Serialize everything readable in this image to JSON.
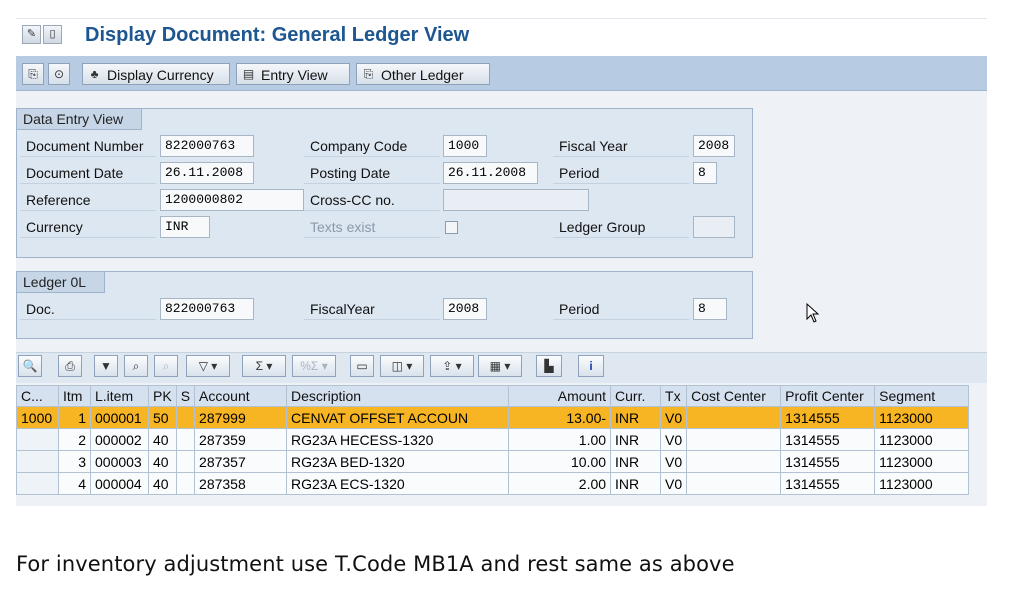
{
  "window": {
    "title": "Display Document: General Ledger View"
  },
  "toolbar": {
    "buttons": [
      {
        "label": "Display Currency",
        "icon": "currency-icon"
      },
      {
        "label": "Entry View",
        "icon": "entry-view-icon"
      },
      {
        "label": "Other Ledger",
        "icon": "other-ledger-icon"
      }
    ]
  },
  "data_entry_view": {
    "title": "Data Entry View",
    "document_number": {
      "label": "Document Number",
      "value": "822000763"
    },
    "company_code": {
      "label": "Company Code",
      "value": "1000"
    },
    "fiscal_year": {
      "label": "Fiscal Year",
      "value": "2008"
    },
    "document_date": {
      "label": "Document Date",
      "value": "26.11.2008"
    },
    "posting_date": {
      "label": "Posting Date",
      "value": "26.11.2008"
    },
    "period": {
      "label": "Period",
      "value": "8"
    },
    "reference": {
      "label": "Reference",
      "value": "1200000802"
    },
    "cross_cc": {
      "label": "Cross-CC no.",
      "value": ""
    },
    "currency": {
      "label": "Currency",
      "value": "INR"
    },
    "texts_exist": {
      "label": "Texts exist",
      "checked": false
    },
    "ledger_group": {
      "label": "Ledger Group",
      "value": ""
    }
  },
  "ledger": {
    "title": "Ledger 0L",
    "doc": {
      "label": "Doc.",
      "value": "822000763"
    },
    "fiscal_year": {
      "label": "FiscalYear",
      "value": "2008"
    },
    "period": {
      "label": "Period",
      "value": "8"
    }
  },
  "table": {
    "columns": [
      "C...",
      "Itm",
      "L.item",
      "PK",
      "S",
      "Account",
      "Description",
      "Amount",
      "Curr.",
      "Tx",
      "Cost Center",
      "Profit Center",
      "Segment"
    ],
    "rows": [
      {
        "c": "1000",
        "itm": "1",
        "litem": "000001",
        "pk": "50",
        "s": "",
        "account": "287999",
        "description": "CENVAT OFFSET ACCOUN",
        "amount": "13.00-",
        "curr": "INR",
        "tx": "V0",
        "cost_center": "",
        "profit_center": "1314555",
        "segment": "1123000",
        "selected": true
      },
      {
        "c": "",
        "itm": "2",
        "litem": "000002",
        "pk": "40",
        "s": "",
        "account": "287359",
        "description": "RG23A HECESS-1320",
        "amount": "1.00",
        "curr": "INR",
        "tx": "V0",
        "cost_center": "",
        "profit_center": "1314555",
        "segment": "1123000",
        "selected": false
      },
      {
        "c": "",
        "itm": "3",
        "litem": "000003",
        "pk": "40",
        "s": "",
        "account": "287357",
        "description": "RG23A BED-1320",
        "amount": "10.00",
        "curr": "INR",
        "tx": "V0",
        "cost_center": "",
        "profit_center": "1314555",
        "segment": "1123000",
        "selected": false
      },
      {
        "c": "",
        "itm": "4",
        "litem": "000004",
        "pk": "40",
        "s": "",
        "account": "287358",
        "description": "RG23A ECS-1320",
        "amount": "2.00",
        "curr": "INR",
        "tx": "V0",
        "cost_center": "",
        "profit_center": "1314555",
        "segment": "1123000",
        "selected": false
      }
    ]
  },
  "footnote": "For inventory adjustment  use T.Code  MB1A and rest same  as above",
  "colors": {
    "title": "#1d5690",
    "selected_row": "#f7b523",
    "toolbar_bg": "#b7cbe3"
  }
}
